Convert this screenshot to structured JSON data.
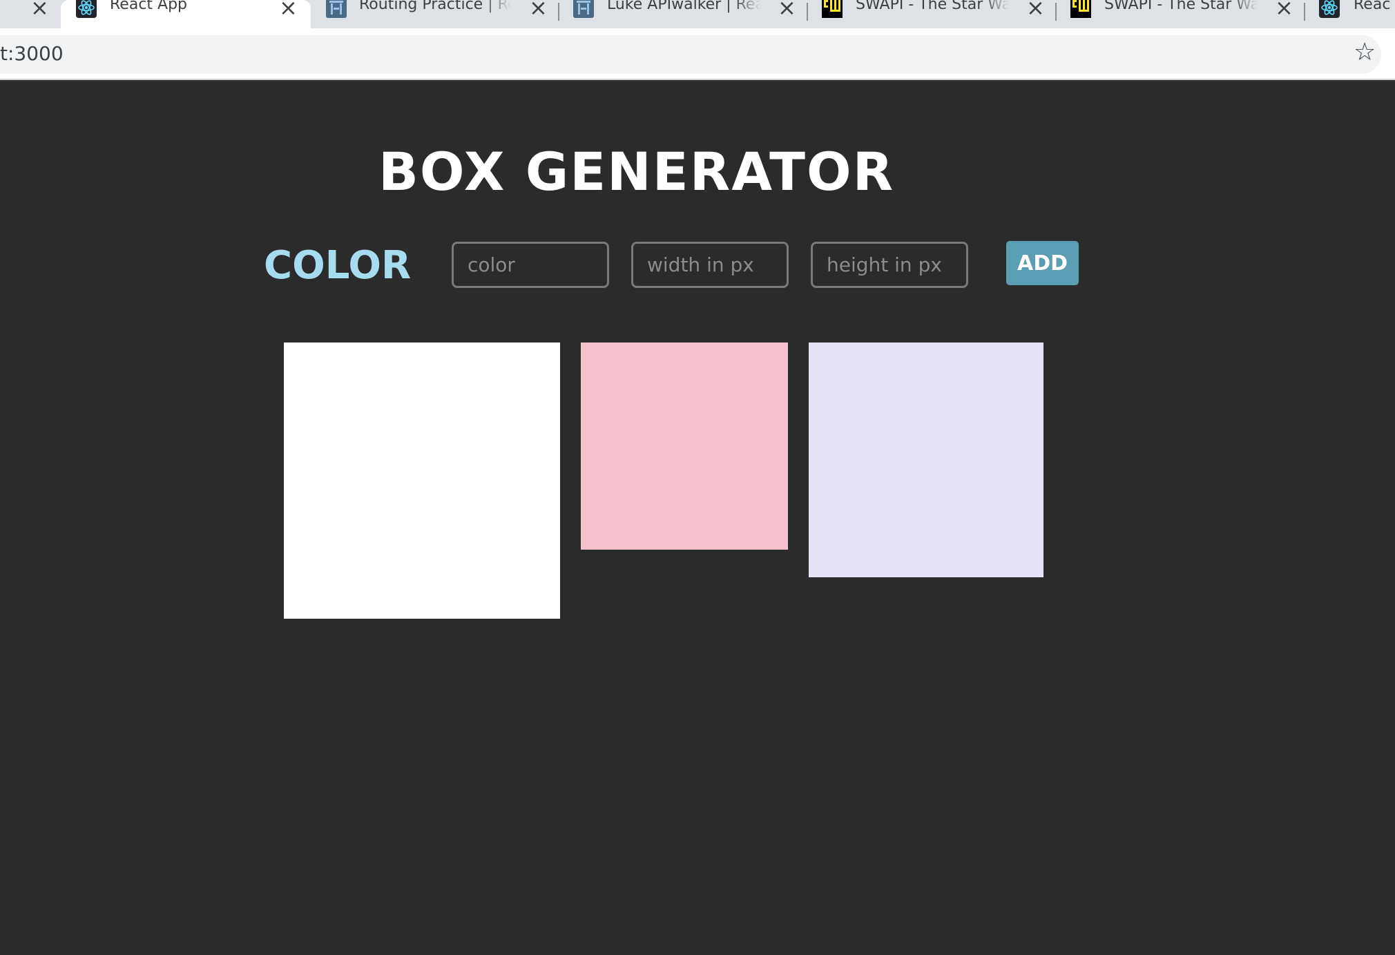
{
  "browser": {
    "tabs": [
      {
        "title": "React App",
        "favicon": "react-icon",
        "active": true
      },
      {
        "title": "Routing Practice | Re",
        "favicon": "stack-icon",
        "active": false
      },
      {
        "title": "Luke APIwalker | Rea",
        "favicon": "stack-icon",
        "active": false
      },
      {
        "title": "SWAPI - The Star Wa",
        "favicon": "swapi-icon",
        "active": false
      },
      {
        "title": "SWAPI - The Star Wa",
        "favicon": "swapi-icon",
        "active": false
      },
      {
        "title": "Reac",
        "favicon": "react-icon",
        "active": false
      }
    ],
    "url": "t:3000"
  },
  "page": {
    "title": "BOX GENERATOR",
    "color_label": "COLOR",
    "inputs": {
      "color_placeholder": "color",
      "width_placeholder": "width in px",
      "height_placeholder": "height in px"
    },
    "add_label": "ADD",
    "boxes": [
      {
        "color": "#ffffff"
      },
      {
        "color": "#f4c2cc"
      },
      {
        "color": "#e6e4f6"
      }
    ]
  }
}
